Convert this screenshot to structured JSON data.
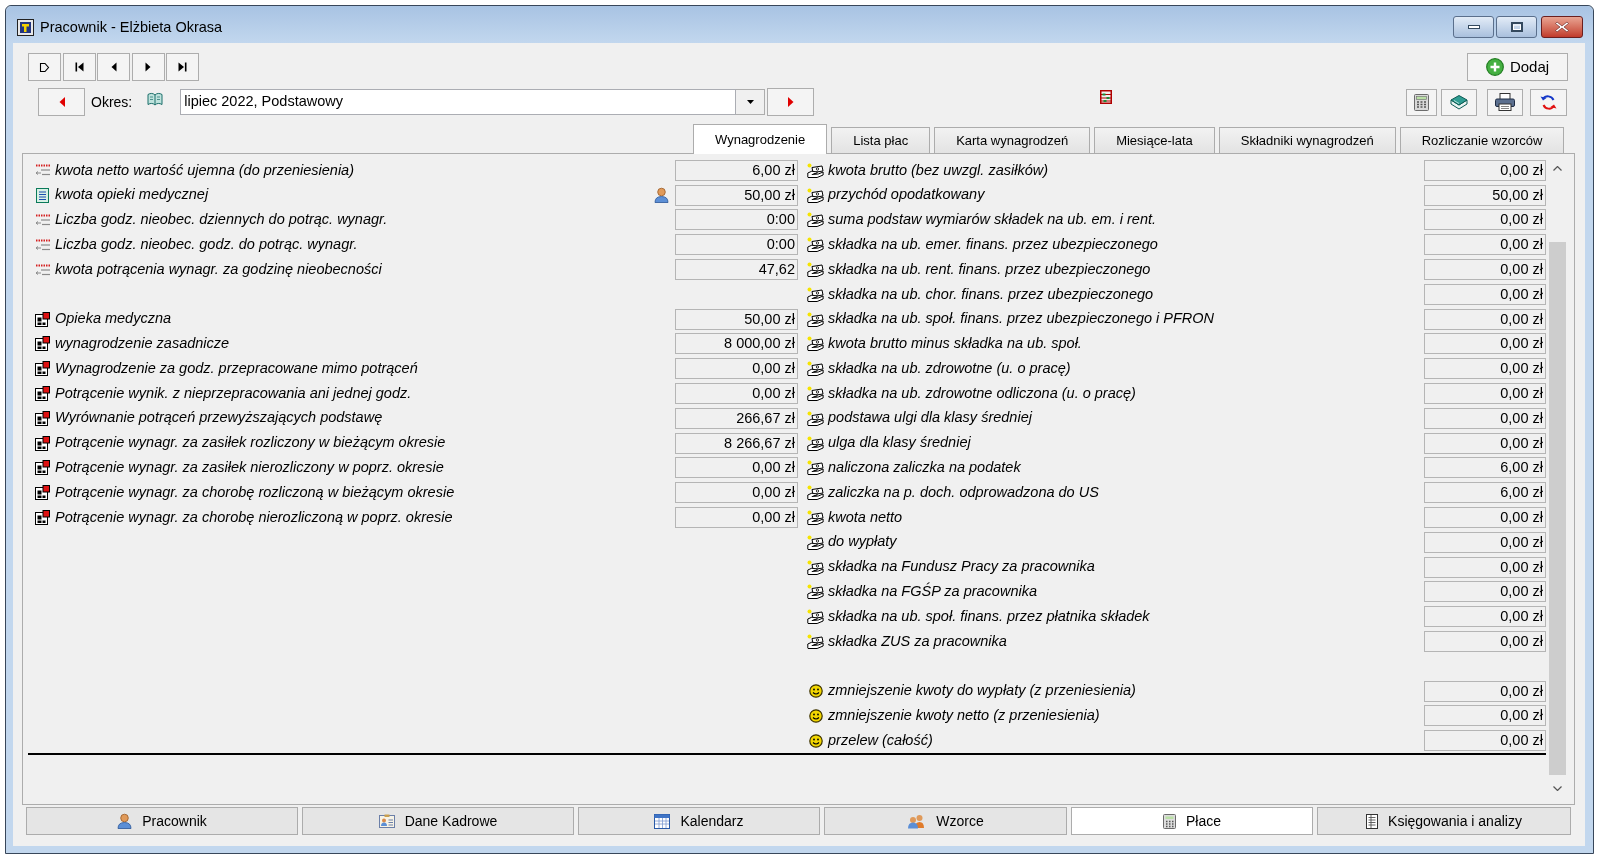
{
  "window": {
    "title": "Pracownik - Elżbieta Okrasa"
  },
  "toolbar": {
    "add_button": "Dodaj"
  },
  "period": {
    "label": "Okres:",
    "value": "lipiec 2022, Podstawowy"
  },
  "tabs": [
    {
      "label": "Wynagrodzenie",
      "selected": true
    },
    {
      "label": "Lista płac",
      "selected": false
    },
    {
      "label": "Karta wynagrodzeń",
      "selected": false
    },
    {
      "label": "Miesiące-lata",
      "selected": false
    },
    {
      "label": "Składniki wynagrodzeń",
      "selected": false
    },
    {
      "label": "Rozliczanie wzorców",
      "selected": false
    }
  ],
  "left_groups": [
    [
      {
        "kind": "dashes",
        "label": "kwota netto wartość ujemna (do przeniesienia)",
        "value": "6,00 zł",
        "person": false
      },
      {
        "kind": "sheet",
        "label": "kwota opieki medycznej",
        "value": "50,00 zł",
        "person": true
      },
      {
        "kind": "dashes",
        "label": "Liczba godz. nieobec. dziennych do potrąc. wynagr.",
        "value": "0:00",
        "person": false
      },
      {
        "kind": "dashes",
        "label": "Liczba godz. nieobec. godz. do potrąc. wynagr.",
        "value": "0:00",
        "person": false
      },
      {
        "kind": "dashes",
        "label": "kwota potrącenia wynagr. za godzinę nieobecności",
        "value": "47,62",
        "person": false
      }
    ],
    [
      {
        "kind": "grid",
        "label": "Opieka medyczna",
        "value": "50,00 zł",
        "person": false
      },
      {
        "kind": "grid",
        "label": "wynagrodzenie zasadnicze",
        "value": "8 000,00 zł",
        "person": false
      },
      {
        "kind": "grid",
        "label": "Wynagrodzenie za godz. przepracowane mimo potrąceń",
        "value": "0,00 zł",
        "person": false
      },
      {
        "kind": "grid",
        "label": "Potrącenie wynik. z nieprzepracowania ani jednej godz.",
        "value": "0,00 zł",
        "person": false
      },
      {
        "kind": "grid",
        "label": "Wyrównanie potrąceń przewyższających podstawę",
        "value": "266,67 zł",
        "person": false
      },
      {
        "kind": "grid",
        "label": "Potrącenie wynagr. za zasiłek rozliczony w bieżącym okresie",
        "value": "8 266,67 zł",
        "person": false
      },
      {
        "kind": "grid",
        "label": "Potrącenie wynagr. za zasiłek nierozliczony w poprz. okresie",
        "value": "0,00 zł",
        "person": false
      },
      {
        "kind": "grid",
        "label": "Potrącenie wynagr. za chorobę rozliczoną w bieżącym okresie",
        "value": "0,00 zł",
        "person": false
      },
      {
        "kind": "grid",
        "label": "Potrącenie wynagr. za chorobę nierozliczoną w poprz. okresie",
        "value": "0,00 zł",
        "person": false
      }
    ]
  ],
  "right_groups": [
    [
      {
        "kind": "hand",
        "label": "kwota brutto (bez uwzgl. zasiłków)",
        "value": "0,00 zł"
      },
      {
        "kind": "hand",
        "label": "przychód opodatkowany",
        "value": "50,00 zł"
      },
      {
        "kind": "hand",
        "label": "suma podstaw wymiarów składek na ub. em. i rent.",
        "value": "0,00 zł"
      },
      {
        "kind": "hand",
        "label": "składka na ub. emer. finans. przez ubezpieczonego",
        "value": "0,00 zł"
      },
      {
        "kind": "hand",
        "label": "składka na ub. rent. finans. przez ubezpieczonego",
        "value": "0,00 zł"
      },
      {
        "kind": "hand",
        "label": "składka na ub. chor. finans. przez ubezpieczonego",
        "value": "0,00 zł"
      },
      {
        "kind": "hand",
        "label": "składka na ub. społ. finans. przez ubezpieczonego i PFRON",
        "value": "0,00 zł"
      },
      {
        "kind": "hand",
        "label": "kwota brutto minus składka na ub. społ.",
        "value": "0,00 zł"
      },
      {
        "kind": "hand",
        "label": "składka na ub. zdrowotne (u. o pracę)",
        "value": "0,00 zł"
      },
      {
        "kind": "hand",
        "label": "składka na ub. zdrowotne odliczona (u. o pracę)",
        "value": "0,00 zł"
      },
      {
        "kind": "hand",
        "label": "podstawa ulgi dla klasy średniej",
        "value": "0,00 zł"
      },
      {
        "kind": "hand",
        "label": "ulga dla klasy średniej",
        "value": "0,00 zł"
      },
      {
        "kind": "hand",
        "label": "naliczona zaliczka na podatek",
        "value": "6,00 zł"
      },
      {
        "kind": "hand",
        "label": "zaliczka na p. doch. odprowadzona do US",
        "value": "6,00 zł"
      },
      {
        "kind": "hand",
        "label": "kwota netto",
        "value": "0,00 zł"
      },
      {
        "kind": "hand",
        "label": "do wypłaty",
        "value": "0,00 zł"
      },
      {
        "kind": "hand",
        "label": "składka na Fundusz Pracy za pracownika",
        "value": "0,00 zł"
      },
      {
        "kind": "hand",
        "label": "składka na FGŚP za pracownika",
        "value": "0,00 zł"
      },
      {
        "kind": "hand",
        "label": "składka na ub. społ. finans. przez płatnika składek",
        "value": "0,00 zł"
      },
      {
        "kind": "hand",
        "label": "składka ZUS za pracownika",
        "value": "0,00 zł"
      }
    ],
    [
      {
        "kind": "smiley",
        "label": "zmniejszenie kwoty do wypłaty (z przeniesienia)",
        "value": "0,00 zł"
      },
      {
        "kind": "smiley",
        "label": "zmniejszenie kwoty netto (z przeniesienia)",
        "value": "0,00 zł"
      },
      {
        "kind": "smiley",
        "label": "przelew (całość)",
        "value": "0,00 zł"
      }
    ]
  ],
  "bottom_tabs": [
    {
      "label": "Pracownik",
      "selected": false
    },
    {
      "label": "Dane Kadrowe",
      "selected": false
    },
    {
      "label": "Kalendarz",
      "selected": false
    },
    {
      "label": "Wzorce",
      "selected": false
    },
    {
      "label": "Płace",
      "selected": true
    },
    {
      "label": "Księgowania i analizy",
      "selected": false
    }
  ]
}
